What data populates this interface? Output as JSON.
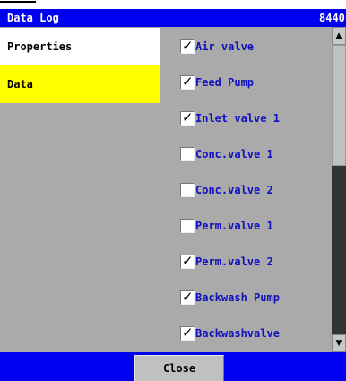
{
  "window": {
    "title": "Data Log",
    "code": "8440"
  },
  "nav": {
    "items": [
      {
        "label": "Properties",
        "selected": false
      },
      {
        "label": "Data",
        "selected": true
      }
    ]
  },
  "checklist": [
    {
      "label": "Air valve",
      "checked": true
    },
    {
      "label": "Feed Pump",
      "checked": true
    },
    {
      "label": "Inlet valve 1",
      "checked": true
    },
    {
      "label": "Conc.valve 1",
      "checked": false
    },
    {
      "label": "Conc.valve 2",
      "checked": false
    },
    {
      "label": "Perm.valve 1",
      "checked": false
    },
    {
      "label": "Perm.valve 2",
      "checked": true
    },
    {
      "label": "Backwash Pump",
      "checked": true
    },
    {
      "label": "Backwashvalve",
      "checked": true
    }
  ],
  "scrollbar": {
    "up_icon": "arrow-up-icon",
    "down_icon": "arrow-down-icon"
  },
  "footer": {
    "close_label": "Close"
  },
  "colors": {
    "title_bar": "#0000f0",
    "selected_nav": "#ffff00",
    "label_text": "#1010c0",
    "panel_bg": "#aaaaaa"
  }
}
